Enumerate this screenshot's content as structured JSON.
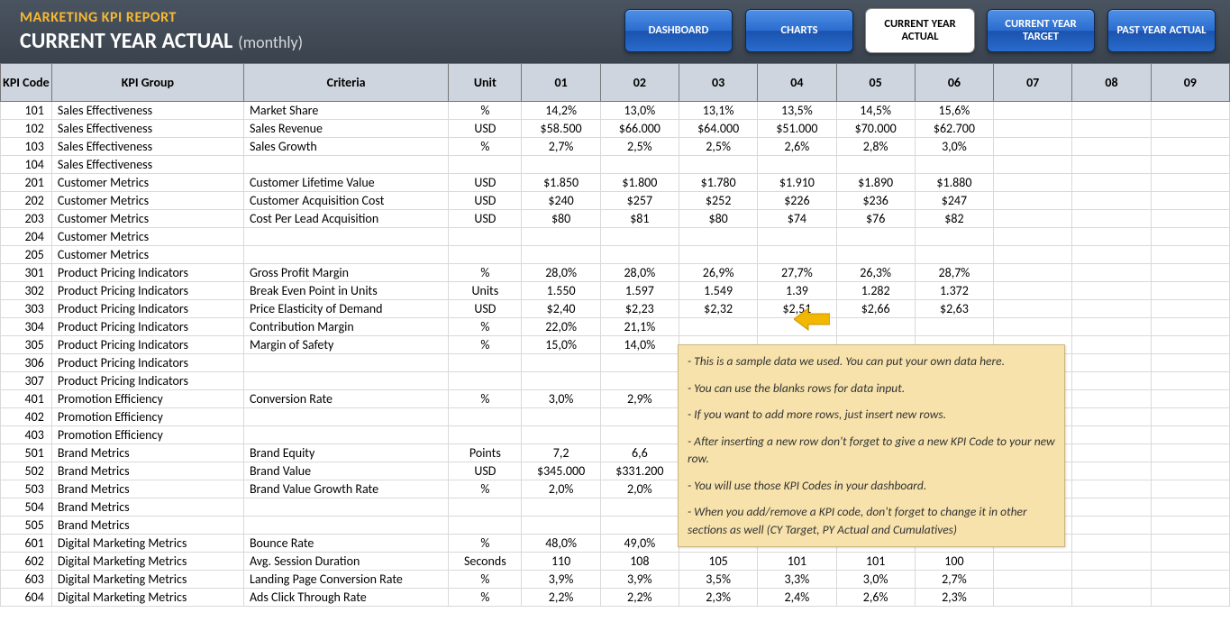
{
  "header": {
    "report_title": "MARKETING KPI REPORT",
    "subtitle_main": "CURRENT YEAR ACTUAL",
    "subtitle_paren": "(monthly)"
  },
  "nav": [
    {
      "label": "DASHBOARD",
      "active": false
    },
    {
      "label": "CHARTS",
      "active": false
    },
    {
      "label": "CURRENT YEAR ACTUAL",
      "active": true
    },
    {
      "label": "CURRENT YEAR TARGET",
      "active": false
    },
    {
      "label": "PAST YEAR ACTUAL",
      "active": false
    }
  ],
  "columns": {
    "code": "KPI Code",
    "group": "KPI Group",
    "criteria": "Criteria",
    "unit": "Unit",
    "months": [
      "01",
      "02",
      "03",
      "04",
      "05",
      "06",
      "07",
      "08",
      "09"
    ]
  },
  "rows": [
    {
      "code": "101",
      "group": "Sales Effectiveness",
      "criteria": "Market Share",
      "unit": "%",
      "v": [
        "14,2%",
        "13,0%",
        "13,1%",
        "13,5%",
        "14,5%",
        "15,6%",
        "",
        "",
        ""
      ]
    },
    {
      "code": "102",
      "group": "Sales Effectiveness",
      "criteria": "Sales Revenue",
      "unit": "USD",
      "v": [
        "$58.500",
        "$66.000",
        "$64.000",
        "$51.000",
        "$70.000",
        "$62.700",
        "",
        "",
        ""
      ]
    },
    {
      "code": "103",
      "group": "Sales Effectiveness",
      "criteria": "Sales Growth",
      "unit": "%",
      "v": [
        "2,7%",
        "2,5%",
        "2,5%",
        "2,6%",
        "2,8%",
        "3,0%",
        "",
        "",
        ""
      ]
    },
    {
      "code": "104",
      "group": "Sales Effectiveness",
      "criteria": "",
      "unit": "",
      "v": [
        "",
        "",
        "",
        "",
        "",
        "",
        "",
        "",
        ""
      ]
    },
    {
      "code": "201",
      "group": "Customer Metrics",
      "criteria": "Customer Lifetime Value",
      "unit": "USD",
      "v": [
        "$1.850",
        "$1.800",
        "$1.780",
        "$1.910",
        "$1.890",
        "$1.880",
        "",
        "",
        ""
      ]
    },
    {
      "code": "202",
      "group": "Customer Metrics",
      "criteria": "Customer Acquisition Cost",
      "unit": "USD",
      "v": [
        "$240",
        "$257",
        "$252",
        "$226",
        "$236",
        "$247",
        "",
        "",
        ""
      ]
    },
    {
      "code": "203",
      "group": "Customer Metrics",
      "criteria": "Cost Per Lead Acquisition",
      "unit": "USD",
      "v": [
        "$80",
        "$81",
        "$80",
        "$74",
        "$76",
        "$82",
        "",
        "",
        ""
      ]
    },
    {
      "code": "204",
      "group": "Customer Metrics",
      "criteria": "",
      "unit": "",
      "v": [
        "",
        "",
        "",
        "",
        "",
        "",
        "",
        "",
        ""
      ]
    },
    {
      "code": "205",
      "group": "Customer Metrics",
      "criteria": "",
      "unit": "",
      "v": [
        "",
        "",
        "",
        "",
        "",
        "",
        "",
        "",
        ""
      ]
    },
    {
      "code": "301",
      "group": "Product Pricing Indicators",
      "criteria": "Gross Profit Margin",
      "unit": "%",
      "v": [
        "28,0%",
        "28,0%",
        "26,9%",
        "27,7%",
        "26,3%",
        "28,7%",
        "",
        "",
        ""
      ]
    },
    {
      "code": "302",
      "group": "Product Pricing Indicators",
      "criteria": "Break Even Point in Units",
      "unit": "Units",
      "v": [
        "1.550",
        "1.597",
        "1.549",
        "1.39",
        "1.282",
        "1.372",
        "",
        "",
        ""
      ]
    },
    {
      "code": "303",
      "group": "Product Pricing Indicators",
      "criteria": "Price Elasticity of Demand",
      "unit": "USD",
      "v": [
        "$2,40",
        "$2,23",
        "$2,32",
        "$2,51",
        "$2,66",
        "$2,63",
        "",
        "",
        ""
      ]
    },
    {
      "code": "304",
      "group": "Product Pricing Indicators",
      "criteria": "Contribution Margin",
      "unit": "%",
      "v": [
        "22,0%",
        "21,1%",
        "",
        "",
        "",
        "",
        "",
        "",
        ""
      ]
    },
    {
      "code": "305",
      "group": "Product Pricing Indicators",
      "criteria": "Margin of Safety",
      "unit": "%",
      "v": [
        "15,0%",
        "14,0%",
        "",
        "",
        "",
        "",
        "",
        "",
        ""
      ]
    },
    {
      "code": "306",
      "group": "Product Pricing Indicators",
      "criteria": "",
      "unit": "",
      "v": [
        "",
        "",
        "",
        "",
        "",
        "",
        "",
        "",
        ""
      ]
    },
    {
      "code": "307",
      "group": "Product Pricing Indicators",
      "criteria": "",
      "unit": "",
      "v": [
        "",
        "",
        "",
        "",
        "",
        "",
        "",
        "",
        ""
      ]
    },
    {
      "code": "401",
      "group": "Promotion Efficiency",
      "criteria": "Conversion Rate",
      "unit": "%",
      "v": [
        "3,0%",
        "2,9%",
        "",
        "",
        "",
        "",
        "",
        "",
        ""
      ]
    },
    {
      "code": "402",
      "group": "Promotion Efficiency",
      "criteria": "",
      "unit": "",
      "v": [
        "",
        "",
        "",
        "",
        "",
        "",
        "",
        "",
        ""
      ]
    },
    {
      "code": "403",
      "group": "Promotion Efficiency",
      "criteria": "",
      "unit": "",
      "v": [
        "",
        "",
        "",
        "",
        "",
        "",
        "",
        "",
        ""
      ]
    },
    {
      "code": "501",
      "group": "Brand Metrics",
      "criteria": "Brand Equity",
      "unit": "Points",
      "v": [
        "7,2",
        "6,6",
        "",
        "",
        "",
        "",
        "",
        "",
        ""
      ]
    },
    {
      "code": "502",
      "group": "Brand Metrics",
      "criteria": "Brand Value",
      "unit": "USD",
      "v": [
        "$345.000",
        "$331.200",
        "",
        "",
        "",
        "",
        "",
        "",
        ""
      ]
    },
    {
      "code": "503",
      "group": "Brand Metrics",
      "criteria": "Brand Value Growth Rate",
      "unit": "%",
      "v": [
        "2,0%",
        "2,0%",
        "",
        "",
        "",
        "",
        "",
        "",
        ""
      ]
    },
    {
      "code": "504",
      "group": "Brand Metrics",
      "criteria": "",
      "unit": "",
      "v": [
        "",
        "",
        "",
        "",
        "",
        "",
        "",
        "",
        ""
      ]
    },
    {
      "code": "505",
      "group": "Brand Metrics",
      "criteria": "",
      "unit": "",
      "v": [
        "",
        "",
        "",
        "",
        "",
        "",
        "",
        "",
        ""
      ]
    },
    {
      "code": "601",
      "group": "Digital Marketing Metrics",
      "criteria": "Bounce Rate",
      "unit": "%",
      "v": [
        "48,0%",
        "49,0%",
        "",
        "",
        "",
        "",
        "",
        "",
        ""
      ]
    },
    {
      "code": "602",
      "group": "Digital Marketing Metrics",
      "criteria": "Avg. Session Duration",
      "unit": "Seconds",
      "v": [
        "110",
        "108",
        "105",
        "101",
        "101",
        "100",
        "",
        "",
        ""
      ]
    },
    {
      "code": "603",
      "group": "Digital Marketing Metrics",
      "criteria": "Landing Page Conversion Rate",
      "unit": "%",
      "v": [
        "3,9%",
        "3,9%",
        "3,5%",
        "3,3%",
        "3,0%",
        "2,7%",
        "",
        "",
        ""
      ]
    },
    {
      "code": "604",
      "group": "Digital Marketing Metrics",
      "criteria": "Ads Click Through Rate",
      "unit": "%",
      "v": [
        "2,2%",
        "2,2%",
        "2,3%",
        "2,4%",
        "2,6%",
        "2,3%",
        "",
        "",
        ""
      ]
    }
  ],
  "tooltip": [
    "- This is a sample data we used. You can put your own data here.",
    "- You can use the blanks rows for data input.",
    "- If you want to add more rows, just insert new rows.",
    "- After inserting a new row don't forget to give a new KPI Code to your new row.",
    "- You will use those KPI Codes in your dashboard.",
    "- When you add/remove a KPI code, don't forget to change it in other sections as well (CY Target, PY Actual and Cumulatives)"
  ]
}
